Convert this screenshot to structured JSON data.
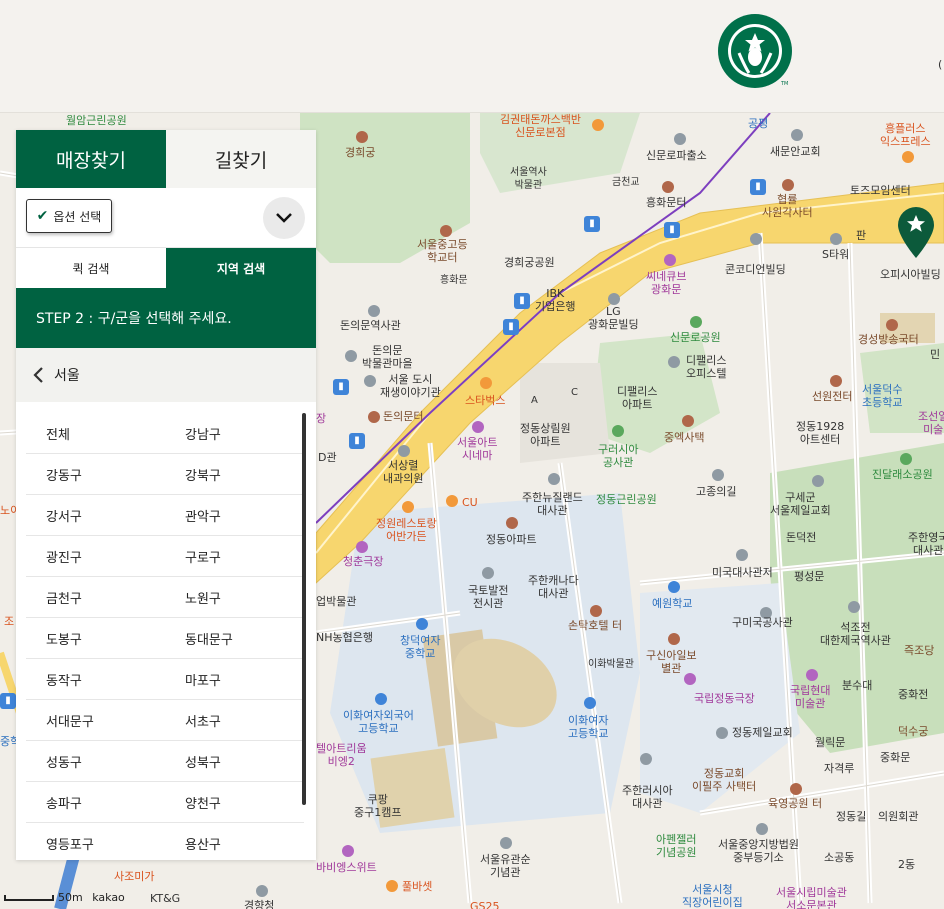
{
  "header": {
    "edge_text": "("
  },
  "panel": {
    "tabs": {
      "store": "매장찾기",
      "route": "길찾기"
    },
    "options_label": "옵션 선택",
    "subtabs": {
      "quick": "퀵 검색",
      "region": "지역 검색"
    },
    "step": "STEP 2 : 구/군을 선택해 주세요.",
    "region": "서울",
    "districts": [
      [
        "전체",
        "강남구"
      ],
      [
        "강동구",
        "강북구"
      ],
      [
        "강서구",
        "관악구"
      ],
      [
        "광진구",
        "구로구"
      ],
      [
        "금천구",
        "노원구"
      ],
      [
        "도봉구",
        "동대문구"
      ],
      [
        "동작구",
        "마포구"
      ],
      [
        "서대문구",
        "서초구"
      ],
      [
        "성동구",
        "성북구"
      ],
      [
        "송파구",
        "양천구"
      ],
      [
        "영등포구",
        "용산구"
      ]
    ]
  },
  "map": {
    "scale": "50m",
    "provider": "kakao",
    "labels": [
      {
        "t": "월암근린공원",
        "c": "green"
      },
      {
        "t": "경희궁",
        "c": "brown"
      },
      {
        "t": "김권태돈까스백반\n신문로본점",
        "c": "orange"
      },
      {
        "t": "서울역사\n박물관",
        "c": ""
      },
      {
        "t": "신문로파출소",
        "c": ""
      },
      {
        "t": "공평",
        "c": "blue"
      },
      {
        "t": "새문안교회",
        "c": ""
      },
      {
        "t": "흥플러스\n익스프레스",
        "c": "orange"
      },
      {
        "t": "금천교",
        "c": ""
      },
      {
        "t": "흥화문터",
        "c": ""
      },
      {
        "t": "협률\n사원각사터",
        "c": "brown"
      },
      {
        "t": "토즈모임센터",
        "c": ""
      },
      {
        "t": "서울중고등\n학교터",
        "c": "brown"
      },
      {
        "t": "경희궁공원",
        "c": ""
      },
      {
        "t": "흥화문",
        "c": ""
      },
      {
        "t": "씨네큐브\n광화문",
        "c": "purple"
      },
      {
        "t": "콘코디언빌딩",
        "c": ""
      },
      {
        "t": "S타워",
        "c": ""
      },
      {
        "t": "오피시아빌딩",
        "c": ""
      },
      {
        "t": "IBK\n기업은행",
        "c": ""
      },
      {
        "t": "LG\n광화문빌딩",
        "c": ""
      },
      {
        "t": "돈의문역사관",
        "c": ""
      },
      {
        "t": "신문로공원",
        "c": "green"
      },
      {
        "t": "경성방송국터",
        "c": "brown"
      },
      {
        "t": "돈의문\n박물관마을",
        "c": ""
      },
      {
        "t": "디팰리스\n오피스텔",
        "c": ""
      },
      {
        "t": "서울 도시\n재생이야기관",
        "c": ""
      },
      {
        "t": "스타벅스",
        "c": "orange"
      },
      {
        "t": "디팰리스\n아파트",
        "c": ""
      },
      {
        "t": "선원전터",
        "c": "brown"
      },
      {
        "t": "서울덕수\n초등학교",
        "c": "blue"
      },
      {
        "t": "조선일\n미술",
        "c": "purple"
      },
      {
        "t": "돈의문터",
        "c": "brown"
      },
      {
        "t": "정동상림원\n아파트",
        "c": ""
      },
      {
        "t": "중엑사택",
        "c": "brown"
      },
      {
        "t": "정동1928\n아트센터",
        "c": ""
      },
      {
        "t": "구러시아\n공사관",
        "c": "green"
      },
      {
        "t": "서울아트\n시네마",
        "c": "purple"
      },
      {
        "t": "서상렬\n내과의원",
        "c": ""
      },
      {
        "t": "진달래소공원",
        "c": "green"
      },
      {
        "t": "고종의길",
        "c": ""
      },
      {
        "t": "주한뉴질랜드\n대사관",
        "c": ""
      },
      {
        "t": "정동근린공원",
        "c": "green"
      },
      {
        "t": "CU",
        "c": "orange"
      },
      {
        "t": "구세군\n서울제일교회",
        "c": ""
      },
      {
        "t": "정원레스토랑\n어반가든",
        "c": "orange"
      },
      {
        "t": "정동아파트",
        "c": ""
      },
      {
        "t": "돈덕전",
        "c": ""
      },
      {
        "t": "주한영국\n대사관",
        "c": ""
      },
      {
        "t": "청춘극장",
        "c": "purple"
      },
      {
        "t": "미국대사관저",
        "c": ""
      },
      {
        "t": "평성문",
        "c": ""
      },
      {
        "t": "국토발전\n전시관",
        "c": ""
      },
      {
        "t": "주한캐나다\n대사관",
        "c": ""
      },
      {
        "t": "업박물관",
        "c": ""
      },
      {
        "t": "예원학교",
        "c": "blue"
      },
      {
        "t": "석조전\n대한제국역사관",
        "c": ""
      },
      {
        "t": "NH농협은행",
        "c": ""
      },
      {
        "t": "손탁호텔 터",
        "c": "brown"
      },
      {
        "t": "구미국공사관",
        "c": ""
      },
      {
        "t": "창덕여자\n중학교",
        "c": "blue"
      },
      {
        "t": "즉조당",
        "c": "brown"
      },
      {
        "t": "이화박물관",
        "c": ""
      },
      {
        "t": "구신아일보\n별관",
        "c": "brown"
      },
      {
        "t": "분수대",
        "c": ""
      },
      {
        "t": "국립정동극장",
        "c": "purple"
      },
      {
        "t": "국립현대\n미술관",
        "c": "purple"
      },
      {
        "t": "중화전",
        "c": ""
      },
      {
        "t": "이화여자외국어\n고등학교",
        "c": "blue"
      },
      {
        "t": "이화여자\n고등학교",
        "c": "blue"
      },
      {
        "t": "정동제일교회",
        "c": ""
      },
      {
        "t": "덕수궁",
        "c": "brown"
      },
      {
        "t": "월릭문",
        "c": ""
      },
      {
        "t": "텔아트리움\n비엥2",
        "c": "purple"
      },
      {
        "t": "중화문",
        "c": ""
      },
      {
        "t": "자격루",
        "c": ""
      },
      {
        "t": "주한러시아\n대사관",
        "c": ""
      },
      {
        "t": "정동교회\n이필주 사택터",
        "c": "brown"
      },
      {
        "t": "육영공원 터",
        "c": "brown"
      },
      {
        "t": "쿠팡\n중구1캠프",
        "c": ""
      },
      {
        "t": "정동길",
        "c": ""
      },
      {
        "t": "의원회관",
        "c": ""
      },
      {
        "t": "아펜젤러\n기념공원",
        "c": "green"
      },
      {
        "t": "서울중앙지방법원\n중부등기소",
        "c": ""
      },
      {
        "t": "소공동",
        "c": ""
      },
      {
        "t": "서울유관순\n기념관",
        "c": ""
      },
      {
        "t": "2동",
        "c": ""
      },
      {
        "t": "사조미가",
        "c": "orange"
      },
      {
        "t": "바비엥스위트",
        "c": "purple"
      },
      {
        "t": "KT&G",
        "c": ""
      },
      {
        "t": "풀바셋",
        "c": "orange"
      },
      {
        "t": "GS25",
        "c": "orange"
      },
      {
        "t": "경향청",
        "c": ""
      },
      {
        "t": "서울시청\n직장어린이집",
        "c": "blue"
      },
      {
        "t": "서울시립미술관\n서소문본관",
        "c": "purple"
      },
      {
        "t": "장",
        "c": "purple"
      },
      {
        "t": "D관",
        "c": ""
      },
      {
        "t": "A",
        "c": ""
      },
      {
        "t": "C",
        "c": ""
      },
      {
        "t": "조",
        "c": "orange"
      },
      {
        "t": "노이",
        "c": "orange"
      },
      {
        "t": "중학",
        "c": "blue"
      },
      {
        "t": "판",
        "c": ""
      },
      {
        "t": "민",
        "c": ""
      }
    ]
  }
}
